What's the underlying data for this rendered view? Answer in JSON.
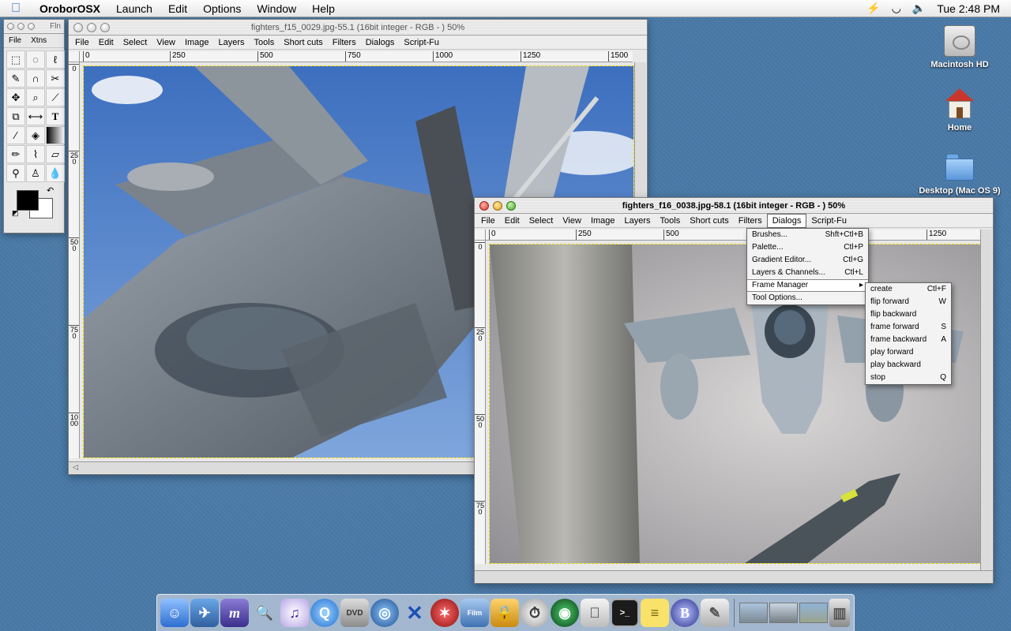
{
  "menubar": {
    "app_name": "OroborOSX",
    "items": [
      "Launch",
      "Edit",
      "Options",
      "Window",
      "Help"
    ],
    "clock": "Tue 2:48 PM"
  },
  "desktop": {
    "icons": [
      {
        "label": "Macintosh HD",
        "icon": "hard-drive-icon"
      },
      {
        "label": "Home",
        "icon": "home-icon"
      },
      {
        "label": "Desktop (Mac OS 9)",
        "icon": "folder-icon"
      }
    ]
  },
  "toolbox": {
    "title": "Fln",
    "menu": [
      "File",
      "Xtns"
    ],
    "tools": [
      "rect-select-icon",
      "ellipse-select-icon",
      "lasso-icon",
      "magic-wand-icon",
      "bezier-icon",
      "scissors-icon",
      "move-icon",
      "magnify-icon",
      "crop-icon",
      "transform-icon",
      "flip-icon",
      "text-icon",
      "color-picker-icon",
      "bucket-fill-icon",
      "gradient-icon",
      "pencil-icon",
      "paintbrush-icon",
      "eraser-icon",
      "airbrush-icon",
      "clone-icon",
      "smudge-icon"
    ]
  },
  "window1": {
    "title": "fighters_f15_0029.jpg-55.1 (16bit integer - RGB - ) 50%",
    "menu": [
      "File",
      "Edit",
      "Select",
      "View",
      "Image",
      "Layers",
      "Tools",
      "Short cuts",
      "Filters",
      "Dialogs",
      "Script-Fu"
    ],
    "ruler_h": [
      "0",
      "250",
      "500",
      "750",
      "1000",
      "1250",
      "1500"
    ],
    "ruler_v": [
      "0",
      "250",
      "500",
      "750",
      "1000"
    ]
  },
  "window2": {
    "title": "fighters_f16_0038.jpg-58.1 (16bit integer - RGB - ) 50%",
    "menu": [
      "File",
      "Edit",
      "Select",
      "View",
      "Image",
      "Layers",
      "Tools",
      "Short cuts",
      "Filters",
      "Dialogs",
      "Script-Fu"
    ],
    "ruler_h": [
      "0",
      "250",
      "500",
      "1250"
    ],
    "ruler_v": [
      "0",
      "250",
      "500",
      "750"
    ]
  },
  "dialogs_menu": [
    {
      "label": "Brushes...",
      "shortcut": "Shft+Ctl+B"
    },
    {
      "label": "Palette...",
      "shortcut": "Ctl+P"
    },
    {
      "label": "Gradient Editor...",
      "shortcut": "Ctl+G"
    },
    {
      "label": "Layers & Channels...",
      "shortcut": "Ctl+L"
    },
    {
      "label": "Frame Manager",
      "shortcut": "▸"
    },
    {
      "label": "Tool Options...",
      "shortcut": ""
    }
  ],
  "frame_menu": [
    {
      "label": "create",
      "shortcut": "Ctl+F"
    },
    {
      "label": "flip forward",
      "shortcut": "W"
    },
    {
      "label": "flip backward",
      "shortcut": ""
    },
    {
      "label": "frame forward",
      "shortcut": "S"
    },
    {
      "label": "frame backward",
      "shortcut": "A"
    },
    {
      "label": "play forward",
      "shortcut": ""
    },
    {
      "label": "play backward",
      "shortcut": ""
    },
    {
      "label": "stop",
      "shortcut": "Q"
    }
  ],
  "dock": {
    "items": [
      "finder-icon",
      "preview-icon",
      "mozilla-icon",
      "sherlock-icon",
      "itunes-icon",
      "quicktime-icon",
      "dvd-player-icon",
      "network-icon",
      "x11-icon",
      "quake-icon",
      "film-gimp-icon",
      "keychain-icon",
      "stopwatch-icon",
      "radar-icon",
      "mac-icon",
      "terminal-icon",
      "stickies-icon",
      "bbedit-icon",
      "pencil-app-icon"
    ],
    "thumbs": [
      "minimized-window-1",
      "minimized-window-2",
      "minimized-window-3"
    ],
    "trash": "trash-icon"
  },
  "colors": {
    "desktop": "#4a7aa8",
    "selection": "#e8d400"
  }
}
